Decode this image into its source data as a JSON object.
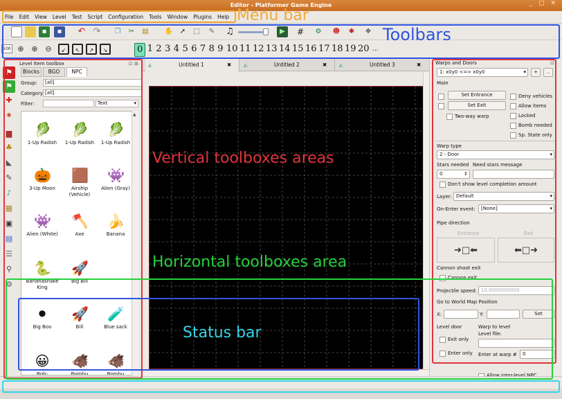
{
  "window": {
    "title": "Editor - Platformer Game Engine",
    "controls": "_ □ ✕"
  },
  "menu": {
    "items": [
      "File",
      "Edit",
      "View",
      "Level",
      "Test",
      "Script",
      "Configuration",
      "Tools",
      "Window",
      "Plugins",
      "Help"
    ]
  },
  "toolbar": {
    "zoom_value": "100",
    "layer_numbers": [
      "0",
      "1",
      "2",
      "3",
      "4",
      "5",
      "6",
      "7",
      "8",
      "9",
      "10",
      "11",
      "12",
      "13",
      "14",
      "15",
      "16",
      "17",
      "18",
      "19",
      "20"
    ],
    "more": "..."
  },
  "level_item_toolbox": {
    "title": "Level Item toolbox",
    "tabs": [
      "Blocks",
      "BGO",
      "NPC"
    ],
    "active_tab": "NPC",
    "group_label": "Group:",
    "group_value": "[all]",
    "category_label": "Category:",
    "category_value": "[all]",
    "filter_label": "Filter:",
    "filter_value": "",
    "filter_mode": "Text",
    "items": [
      {
        "label": "1-Up Radish",
        "icon": "radish-icon",
        "glyph": "🥬"
      },
      {
        "label": "1-Up Radish",
        "icon": "radish-icon",
        "glyph": "🥬"
      },
      {
        "label": "1-Up Radish",
        "icon": "radish-icon",
        "glyph": "🥬"
      },
      {
        "label": "3-Up Moon",
        "icon": "moon-icon",
        "glyph": "🎃"
      },
      {
        "label": "Airship (Vehicle)",
        "icon": "airship-icon",
        "glyph": "🟫"
      },
      {
        "label": "Alien (Gray)",
        "icon": "alien-icon",
        "glyph": "👾"
      },
      {
        "label": "Alien (White)",
        "icon": "alien-white-icon",
        "glyph": "👾"
      },
      {
        "label": "Axe",
        "icon": "axe-icon",
        "glyph": "🪓"
      },
      {
        "label": "Banana",
        "icon": "banana-icon",
        "glyph": "🍌"
      },
      {
        "label": "Bananasnake King",
        "icon": "snake-icon",
        "glyph": "🐍"
      },
      {
        "label": "Big Bill",
        "icon": "big-bill-icon",
        "glyph": "🚀"
      },
      {
        "label": "",
        "icon": "",
        "glyph": ""
      },
      {
        "label": "Big Boo",
        "icon": "boo-icon",
        "glyph": "⚫"
      },
      {
        "label": "Bill",
        "icon": "bill-icon",
        "glyph": "🚀"
      },
      {
        "label": "Blue sack",
        "icon": "sack-icon",
        "glyph": "🧪"
      },
      {
        "label": "Bob-",
        "icon": "bobomb-icon",
        "glyph": "😀"
      },
      {
        "label": "Bombu",
        "icon": "bombu-icon",
        "glyph": "🐗"
      },
      {
        "label": "Bombu",
        "icon": "bombu-icon",
        "glyph": "🐗"
      }
    ]
  },
  "documents": {
    "tabs": [
      "Untitled 1",
      "Untitled 2",
      "Untitled 3"
    ],
    "close_glyph": "✖"
  },
  "warps": {
    "title": "Warps and Doors",
    "selected_warp": "1: x0y0 <=> x0y0",
    "add_btn": "+",
    "main_label": "Main",
    "set_entrance": "Set Entrance",
    "set_exit": "Set Exit",
    "two_way": "Two-way warp",
    "options": [
      "Deny vehicles",
      "Allow items",
      "Locked",
      "Bomb needed",
      "Sp. State only"
    ],
    "warp_type_label": "Warp type",
    "warp_type_value": "2 - Door",
    "stars_needed_label": "Stars needed",
    "need_stars_msg_label": "Need stars message",
    "stars_value": "0",
    "dont_show": "Don't show level completion amount",
    "layer_label": "Layer:",
    "layer_value": "Default",
    "onenter_label": "On-Enter event:",
    "onenter_value": "[None]",
    "pipe_direction": "Pipe direction",
    "entrance": "Entrance",
    "exit": "Exit",
    "cannon_shoot_exit": "Cannon shoot exit",
    "cannon_exit": "Cannon exit",
    "projectile_speed_label": "Projectile speed:",
    "projectile_speed_value": "10,0000000000",
    "goto_world": "Go to World Map Position",
    "x_label": "X:",
    "y_label": "Y:",
    "set_btn": "Set",
    "level_door": "Level door",
    "warp_to_level": "Warp to level",
    "exit_only": "Exit only",
    "enter_only": "Enter only",
    "level_file": "Level file:",
    "enter_at_warp": "Enter at warp #",
    "enter_at_warp_value": "0",
    "allow_npc": "Allow inter-level NPC"
  },
  "annotations": [
    {
      "text": "Menu bar",
      "color": "#f0a93a"
    },
    {
      "text": "Toolbars",
      "color": "#2f55e0"
    },
    {
      "text": "Vertical toolboxes areas",
      "color": "#e0343c"
    },
    {
      "text": "Horizontal toolboxes area",
      "color": "#25d13c"
    },
    {
      "text": "Status bar",
      "color": "#35d4e5"
    }
  ]
}
